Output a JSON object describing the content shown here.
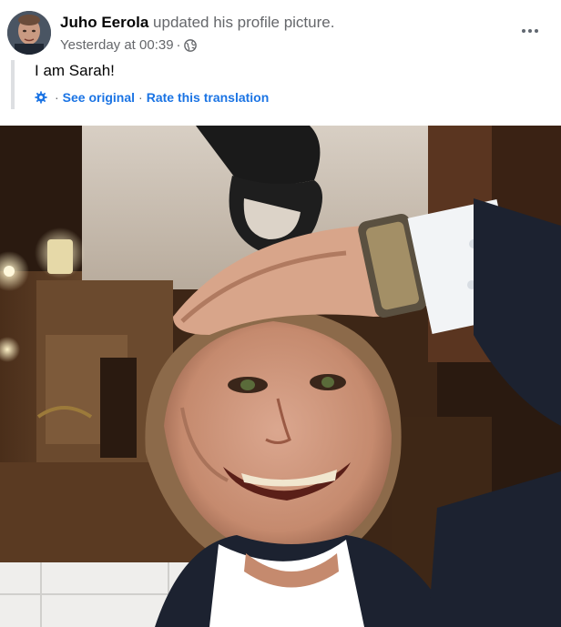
{
  "post": {
    "author": "Juho Eerola",
    "action": "updated his profile picture.",
    "timestamp": "Yesterday at 00:39",
    "meta_separator": "·",
    "audience_icon": "globe-icon",
    "more_icon": "more-options-icon",
    "text": "I am Sarah!",
    "translation": {
      "icon": "gear-icon",
      "see_original": "See original",
      "rate": "Rate this translation",
      "separator": "·"
    }
  },
  "colors": {
    "link": "#1b74e4",
    "secondary_text": "#65676b",
    "primary_text": "#050505",
    "quote_border": "#dddfe2"
  }
}
